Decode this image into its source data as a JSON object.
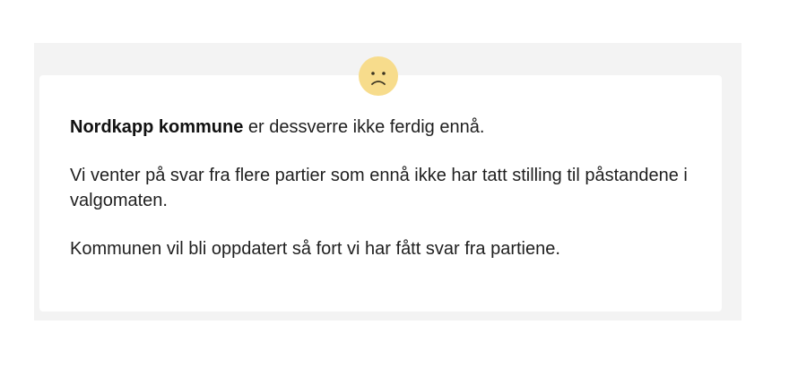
{
  "icon": {
    "name": "sad-face-icon",
    "color": "#f7dc8c"
  },
  "message": {
    "municipality": "Nordkapp kommune",
    "line1_rest": " er dessverre ikke ferdig ennå.",
    "paragraph2": "Vi venter på svar fra flere partier som ennå ikke har tatt stilling til påstandene i valgomaten.",
    "paragraph3": "Kommunen vil bli oppdatert så fort vi har fått svar fra partiene."
  }
}
